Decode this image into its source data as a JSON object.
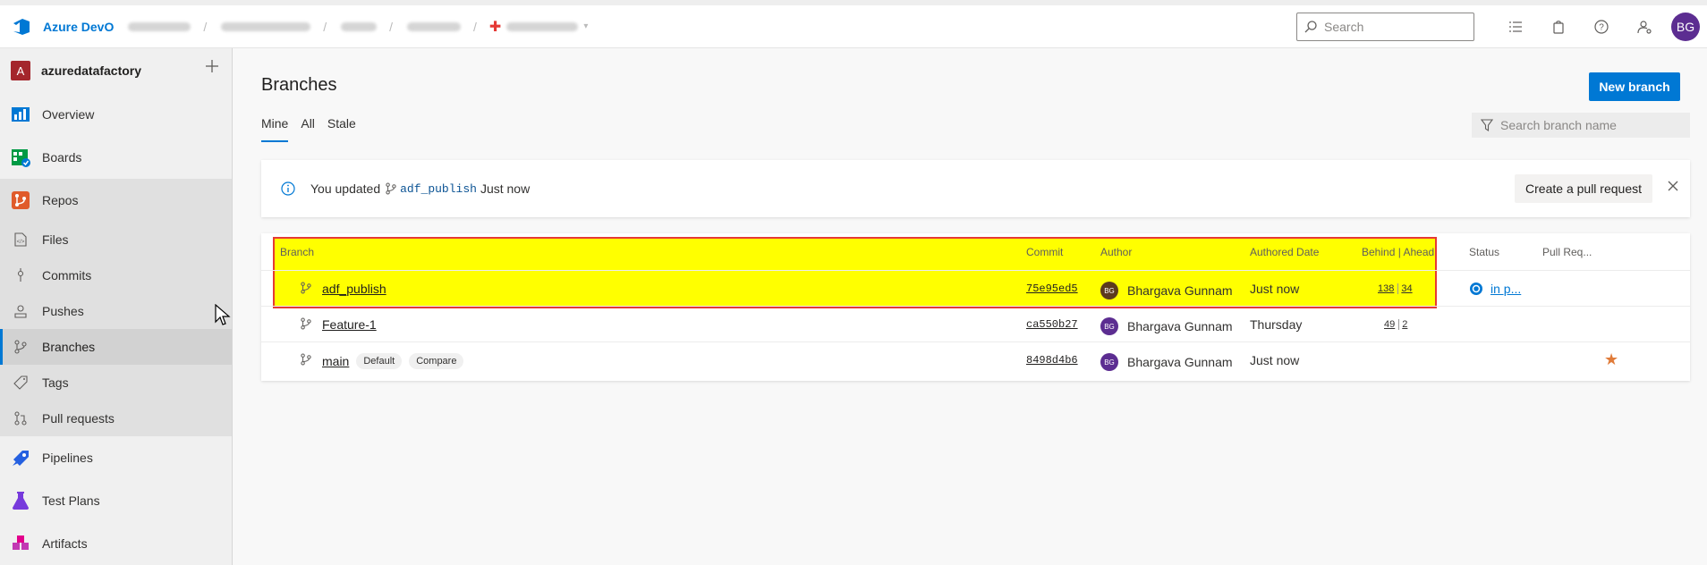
{
  "topbar": {
    "brand": "Azure DevO",
    "search_placeholder": "Search",
    "avatar_initials": "BG"
  },
  "sidebar": {
    "project_initial": "A",
    "project_name": "azuredatafactory",
    "nav": {
      "overview": "Overview",
      "boards": "Boards",
      "repos": "Repos",
      "pipelines": "Pipelines",
      "test_plans": "Test Plans",
      "artifacts": "Artifacts"
    },
    "repos_sub": {
      "files": "Files",
      "commits": "Commits",
      "pushes": "Pushes",
      "branches": "Branches",
      "tags": "Tags",
      "pull_requests": "Pull requests"
    }
  },
  "main": {
    "title": "Branches",
    "new_branch_label": "New branch",
    "tabs": [
      "Mine",
      "All",
      "Stale"
    ],
    "search_placeholder": "Search branch name",
    "banner": {
      "prefix": "You updated",
      "branch": "adf_publish",
      "suffix": "Just now",
      "create_pr_label": "Create a pull request"
    },
    "table": {
      "headers": {
        "branch": "Branch",
        "commit": "Commit",
        "author": "Author",
        "date": "Authored Date",
        "behind_ahead": "Behind | Ahead",
        "status": "Status",
        "pull_request": "Pull Req..."
      },
      "rows": [
        {
          "branch": "adf_publish",
          "commit": "75e95ed5",
          "avatar": "BG",
          "author": "Bhargava Gunnam",
          "date": "Just now",
          "behind": "138",
          "ahead": "34",
          "status": "in p..."
        },
        {
          "branch": "Feature-1",
          "commit": "ca550b27",
          "avatar": "BG",
          "author": "Bhargava Gunnam",
          "date": "Thursday",
          "behind": "49",
          "ahead": "2"
        },
        {
          "branch": "main",
          "commit": "8498d4b6",
          "avatar": "BG",
          "author": "Bhargava Gunnam",
          "date": "Just now",
          "pills": [
            "Default",
            "Compare"
          ]
        }
      ]
    }
  },
  "colors": {
    "accent": "#0078d4",
    "highlight": "#ffff00",
    "highlight_border": "#e53935",
    "avatar_purple": "#5c2d91",
    "project_red": "#a4262c",
    "star": "#e07b39"
  }
}
